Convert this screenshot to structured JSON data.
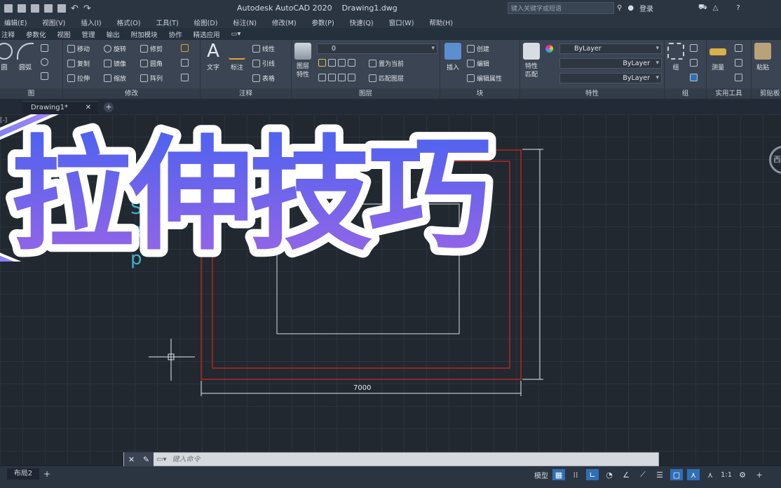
{
  "app": {
    "title": "Autodesk AutoCAD 2020",
    "file": "Drawing1.dwg",
    "search_placeholder": "键入关键字或短语",
    "login": "登录"
  },
  "menus": [
    "编辑(E)",
    "视图(V)",
    "插入(I)",
    "格式(O)",
    "工具(T)",
    "绘图(D)",
    "标注(N)",
    "修改(M)",
    "参数(P)",
    "窗口(W)",
    "帮助(H)",
    "快速(Q)"
  ],
  "ribbon_tabs": [
    "注释",
    "参数化",
    "视图",
    "管理",
    "输出",
    "附加模块",
    "协作",
    "精选应用"
  ],
  "ribbon": {
    "draw": {
      "labels": [
        "圆",
        "圆弧"
      ],
      "title": "图"
    },
    "modify": {
      "title": "修改",
      "tools": [
        "移动",
        "旋转",
        "修剪",
        "复制",
        "镜像",
        "圆角",
        "拉伸",
        "缩放",
        "阵列"
      ]
    },
    "annotation": {
      "title": "注释",
      "text": "文字",
      "dim": "标注",
      "linear": "线性",
      "leader": "引线",
      "table": "表格"
    },
    "layers": {
      "title": "图层",
      "props": "图层\n特性",
      "current_layer": "0",
      "make_current": "置为当前",
      "match_layer": "匹配图层"
    },
    "block": {
      "title": "块",
      "insert": "插入",
      "create": "创建",
      "edit": "编辑",
      "edit_attr": "编辑属性"
    },
    "properties": {
      "title": "特性",
      "match": "特性\n匹配",
      "color": "ByLayer",
      "linetype": "ByLayer",
      "lineweight": "ByLayer"
    },
    "groups": {
      "title": "组",
      "group": "组"
    },
    "utilities": {
      "title": "实用工具",
      "measure": "测量"
    },
    "clipboard": {
      "title": "剪贴板",
      "paste": "粘贴"
    }
  },
  "doc_tabs": [
    {
      "label": "Drawing1*",
      "close": "✕"
    }
  ],
  "canvas": {
    "ucs_letters": [
      "S",
      "R",
      "p"
    ],
    "dimension_value": "7000",
    "viewcube_label": "西"
  },
  "overlay": {
    "title": "拉伸技巧"
  },
  "command": {
    "placeholder": "键入命令"
  },
  "status": {
    "layout_tab": "布局2",
    "model_label": "模型",
    "scale": "1:1"
  },
  "colors": {
    "rect_red": "#b8261f",
    "overlay_gradient_top": "#4a63f0",
    "overlay_gradient_bottom": "#9a64e6",
    "status_active": "#2f6fb6"
  }
}
